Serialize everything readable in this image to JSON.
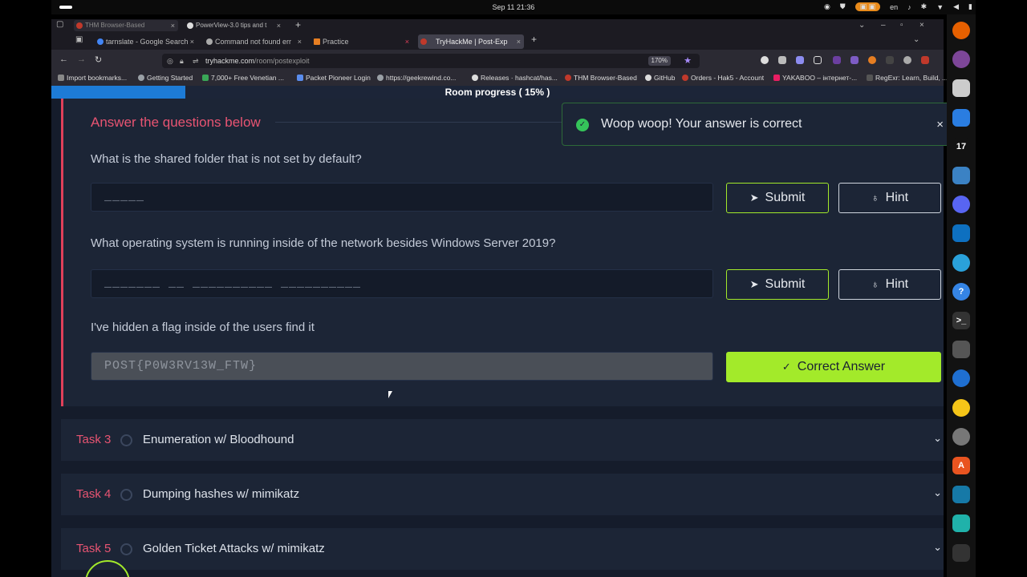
{
  "os": {
    "clock": "Sep 11  21:36",
    "lang": "en"
  },
  "tabs_row1": [
    {
      "label": "THM Browser-Based"
    },
    {
      "label": "PowerView-3.0 tips and t"
    }
  ],
  "tabs_row2": [
    {
      "label": "tarnslate - Google Search"
    },
    {
      "label": "Command not found err"
    },
    {
      "label": "Practice"
    },
    {
      "label": "TryHackMe | Post-Exp"
    }
  ],
  "url": {
    "host": "tryhackme.com",
    "path": "/room/postexploit",
    "zoom": "170%"
  },
  "bookmarks": [
    {
      "label": "Import bookmarks...",
      "color": "#888888"
    },
    {
      "label": "Getting Started",
      "color": "#9aa0a6"
    },
    {
      "label": "7,000+ Free Venetian ...",
      "color": "#3aa757"
    },
    {
      "label": "Packet Pioneer Login",
      "color": "#5a8dee"
    },
    {
      "label": "https://geekrewind.co...",
      "color": "#9aa0a6"
    },
    {
      "label": "Releases · hashcat/has...",
      "color": "#dddddd"
    },
    {
      "label": "THM Browser-Based",
      "color": "#c0392b"
    },
    {
      "label": "GitHub",
      "color": "#dddddd"
    },
    {
      "label": "Orders - Hak5 - Account",
      "color": "#c0392b"
    },
    {
      "label": "YAKABOO – інтернет-...",
      "color": "#e91e63"
    },
    {
      "label": "RegExr: Learn, Build, ...",
      "color": "#555555"
    }
  ],
  "progress": {
    "label": "Room progress ( 15% )",
    "fraction": 0.15
  },
  "task": {
    "heading": "Answer the questions below",
    "questions": [
      {
        "text": "What is the shared folder that is not set by default?",
        "answer": "_____",
        "submit": "Submit",
        "hint": "Hint"
      },
      {
        "text": "What operating system is running inside of the network besides Windows Server 2019?",
        "answer": "_______ __ __________ __________",
        "submit": "Submit",
        "hint": "Hint"
      },
      {
        "text": "I've hidden a flag inside of the users find it",
        "answer": "POST{P0W3RV13W_FTW}",
        "correct": "Correct Answer"
      }
    ]
  },
  "tasks": [
    {
      "num": "Task 3",
      "title": "Enumeration w/ Bloodhound"
    },
    {
      "num": "Task 4",
      "title": "Dumping hashes w/ mimikatz"
    },
    {
      "num": "Task 5",
      "title": "Golden Ticket Attacks w/ mimikatz"
    }
  ],
  "toast": {
    "message": "Woop woop! Your answer is correct"
  },
  "dock": [
    {
      "name": "firefox-icon",
      "color": "#e66000",
      "glyph": ""
    },
    {
      "name": "tor-icon",
      "color": "#7d4698",
      "glyph": ""
    },
    {
      "name": "files-icon",
      "color": "#cccccc",
      "glyph": ""
    },
    {
      "name": "docs-icon",
      "color": "#2a7de1",
      "glyph": ""
    },
    {
      "name": "tradingview-icon",
      "color": "#121212",
      "glyph": "17"
    },
    {
      "name": "weather-icon",
      "color": "#3b82c4",
      "glyph": ""
    },
    {
      "name": "discord-icon",
      "color": "#5865f2",
      "glyph": ""
    },
    {
      "name": "vscode-icon",
      "color": "#0e70c0",
      "glyph": ""
    },
    {
      "name": "telegram-icon",
      "color": "#2aa1da",
      "glyph": ""
    },
    {
      "name": "help-icon",
      "color": "#3584e4",
      "glyph": "?"
    },
    {
      "name": "terminal-icon",
      "color": "#333333",
      "glyph": ">_"
    },
    {
      "name": "gimp-icon",
      "color": "#555555",
      "glyph": ""
    },
    {
      "name": "thunderbird-icon",
      "color": "#1f6fd1",
      "glyph": ""
    },
    {
      "name": "rhythmbox-icon",
      "color": "#f5c518",
      "glyph": ""
    },
    {
      "name": "clock-icon",
      "color": "#777777",
      "glyph": ""
    },
    {
      "name": "appcenter-icon",
      "color": "#e95420",
      "glyph": "A"
    },
    {
      "name": "wireshark-icon",
      "color": "#1679a7",
      "glyph": ""
    },
    {
      "name": "powershell-icon",
      "color": "#20b2aa",
      "glyph": ""
    },
    {
      "name": "settings-icon",
      "color": "#333333",
      "glyph": ""
    }
  ]
}
